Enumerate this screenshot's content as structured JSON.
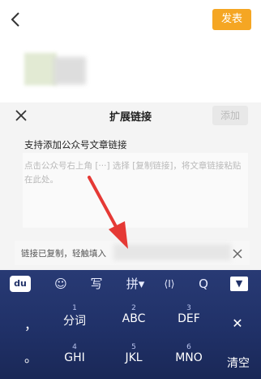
{
  "top_bar": {
    "publish_label": "发表"
  },
  "sheet": {
    "title": "扩展链接",
    "add_label": "添加",
    "hint": "支持添加公众号文章链接",
    "placeholder": "点击公众号右上角 [···] 选择 [复制链接]，将文章链接粘贴在此处。",
    "clipboard_text": "链接已复制，轻触填入"
  },
  "keyboard": {
    "toolbar": [
      {
        "name": "du-logo-icon",
        "glyph": "du"
      },
      {
        "name": "emoji-icon",
        "glyph": "☺"
      },
      {
        "name": "handwrite-icon",
        "glyph": "写"
      },
      {
        "name": "pinyin-icon",
        "glyph": "拼▾"
      },
      {
        "name": "cursor-icon",
        "glyph": "⟨I⟩"
      },
      {
        "name": "search-icon",
        "glyph": "Q"
      },
      {
        "name": "hide-keyboard-icon",
        "glyph": "▼"
      }
    ],
    "row1": [
      {
        "num": "1",
        "label": "分词"
      },
      {
        "num": "2",
        "label": "ABC"
      },
      {
        "num": "3",
        "label": "DEF"
      }
    ],
    "row2": [
      {
        "num": "4",
        "label": "GHI"
      },
      {
        "num": "5",
        "label": "JKL"
      },
      {
        "num": "6",
        "label": "MNO"
      }
    ],
    "left_punct": "，",
    "left_punct2": "。",
    "delete_label": "✕",
    "clear_label": "清空"
  }
}
